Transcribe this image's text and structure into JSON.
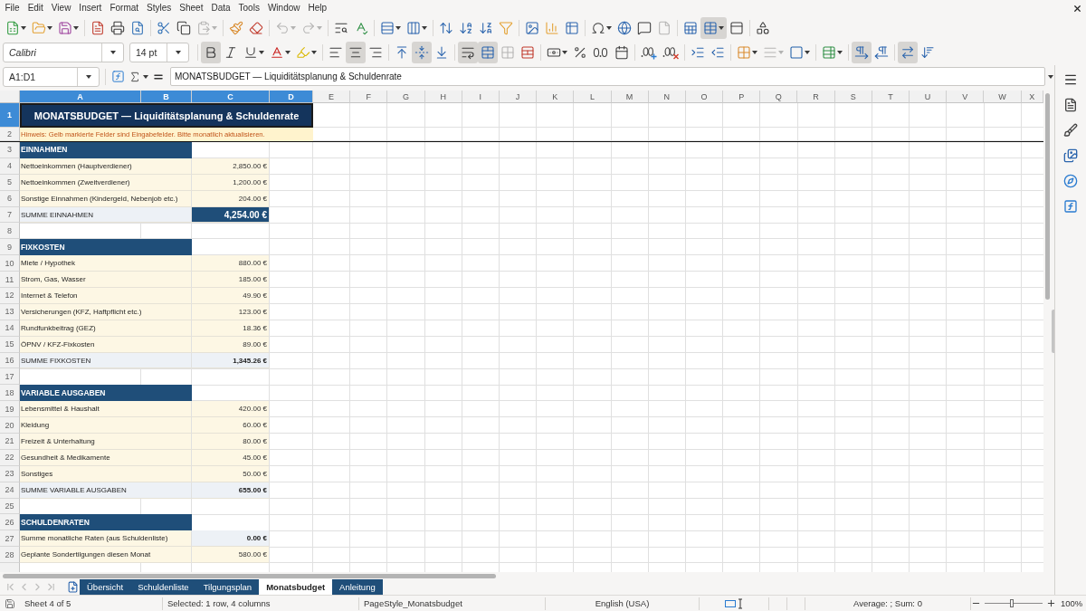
{
  "menu": [
    "File",
    "Edit",
    "View",
    "Insert",
    "Format",
    "Styles",
    "Sheet",
    "Data",
    "Tools",
    "Window",
    "Help"
  ],
  "standard_toolbar": {
    "paste": {
      "disabled": true
    },
    "undo": {
      "disabled": true
    },
    "redo": {
      "disabled": true
    },
    "headers_footers": {
      "disabled": true
    },
    "freeze_cells": {
      "pressed": true
    }
  },
  "formatting_toolbar": {
    "font_name": "Calibri",
    "font_size": "14 pt",
    "bold": {
      "pressed": true
    },
    "italic": {
      "pressed": false
    },
    "underline": {
      "pressed": false
    },
    "align_left": {
      "pressed": false
    },
    "align_center": {
      "pressed": true
    },
    "align_right": {
      "pressed": false
    },
    "align_top": {
      "pressed": false
    },
    "align_middle": {
      "pressed": true
    },
    "align_bottom": {
      "pressed": false
    },
    "wrap_text": {
      "pressed": true
    },
    "merge_and_center": {
      "pressed": true
    },
    "merge_cells": {
      "disabled": true
    },
    "border_style": {
      "disabled": true
    },
    "left_to_right": {
      "pressed": true
    },
    "right_to_left": {
      "pressed": false
    },
    "text_horizontal": {
      "pressed": true
    },
    "text_vertical": {
      "pressed": false
    }
  },
  "formula_bar": {
    "name_box": "A1:D1",
    "content": "MONATSBUDGET — Liquiditätsplanung & Schuldenrate"
  },
  "sheet": {
    "columns": [
      {
        "label": "A",
        "selected": true
      },
      {
        "label": "B",
        "selected": true
      },
      {
        "label": "C",
        "selected": true
      },
      {
        "label": "D",
        "selected": true
      },
      {
        "label": "E",
        "selected": false
      },
      {
        "label": "F",
        "selected": false
      },
      {
        "label": "G",
        "selected": false
      },
      {
        "label": "H",
        "selected": false
      },
      {
        "label": "I",
        "selected": false
      },
      {
        "label": "J",
        "selected": false
      },
      {
        "label": "K",
        "selected": false
      },
      {
        "label": "L",
        "selected": false
      },
      {
        "label": "M",
        "selected": false
      },
      {
        "label": "N",
        "selected": false
      },
      {
        "label": "O",
        "selected": false
      },
      {
        "label": "P",
        "selected": false
      },
      {
        "label": "Q",
        "selected": false
      },
      {
        "label": "R",
        "selected": false
      },
      {
        "label": "S",
        "selected": false
      },
      {
        "label": "T",
        "selected": false
      },
      {
        "label": "U",
        "selected": false
      },
      {
        "label": "V",
        "selected": false
      },
      {
        "label": "W",
        "selected": false
      },
      {
        "label": "X",
        "selected": false
      }
    ],
    "rows": [
      {
        "number": "1",
        "selected": true,
        "kind": "title",
        "label": "MONATSBUDGET — Liquiditätsplanung & Schuldenrate"
      },
      {
        "number": "2",
        "selected": false,
        "kind": "note",
        "label": "Hinweis: Gelb markierte Felder sind Eingabefelder. Bitte monatlich aktualisieren."
      },
      {
        "number": "3",
        "selected": false,
        "kind": "section",
        "label": "EINNAHMEN"
      },
      {
        "number": "4",
        "selected": false,
        "kind": "entry",
        "label": "Nettoeinkommen (Hauptverdiener)",
        "value": "2,850.00 €"
      },
      {
        "number": "5",
        "selected": false,
        "kind": "entry",
        "label": "Nettoeinkommen (Zweitverdiener)",
        "value": "1,200.00 €"
      },
      {
        "number": "6",
        "selected": false,
        "kind": "entry",
        "label": "Sonstige Einnahmen (Kindergeld, Nebenjob etc.)",
        "value": "204.00 €"
      },
      {
        "number": "7",
        "selected": false,
        "kind": "grand_total",
        "label": "SUMME EINNAHMEN",
        "value": "4,254.00 €"
      },
      {
        "number": "8",
        "selected": false,
        "kind": "blank"
      },
      {
        "number": "9",
        "selected": false,
        "kind": "section",
        "label": "FIXKOSTEN"
      },
      {
        "number": "10",
        "selected": false,
        "kind": "entry",
        "label": "Miete / Hypothek",
        "value": "880.00 €"
      },
      {
        "number": "11",
        "selected": false,
        "kind": "entry",
        "label": "Strom, Gas, Wasser",
        "value": "185.00 €"
      },
      {
        "number": "12",
        "selected": false,
        "kind": "entry",
        "label": "Internet & Telefon",
        "value": "49.90 €"
      },
      {
        "number": "13",
        "selected": false,
        "kind": "entry",
        "label": "Versicherungen (KFZ, Haftpflicht etc.)",
        "value": "123.00 €"
      },
      {
        "number": "14",
        "selected": false,
        "kind": "entry",
        "label": "Rundfunkbeitrag (GEZ)",
        "value": "18.36 €"
      },
      {
        "number": "15",
        "selected": false,
        "kind": "entry",
        "label": "ÖPNV / KFZ-Fixkosten",
        "value": "89.00 €"
      },
      {
        "number": "16",
        "selected": false,
        "kind": "total",
        "label": "SUMME FIXKOSTEN",
        "value": "1,345.26 €"
      },
      {
        "number": "17",
        "selected": false,
        "kind": "blank"
      },
      {
        "number": "18",
        "selected": false,
        "kind": "section",
        "label": "VARIABLE AUSGABEN"
      },
      {
        "number": "19",
        "selected": false,
        "kind": "entry",
        "label": "Lebensmittel & Haushalt",
        "value": "420.00 €"
      },
      {
        "number": "20",
        "selected": false,
        "kind": "entry",
        "label": "Kleidung",
        "value": "60.00 €"
      },
      {
        "number": "21",
        "selected": false,
        "kind": "entry",
        "label": "Freizeit & Unterhaltung",
        "value": "80.00 €"
      },
      {
        "number": "22",
        "selected": false,
        "kind": "entry",
        "label": "Gesundheit & Medikamente",
        "value": "45.00 €"
      },
      {
        "number": "23",
        "selected": false,
        "kind": "entry",
        "label": "Sonstiges",
        "value": "50.00 €"
      },
      {
        "number": "24",
        "selected": false,
        "kind": "total",
        "label": "SUMME VARIABLE AUSGABEN",
        "value": "655.00 €"
      },
      {
        "number": "25",
        "selected": false,
        "kind": "blank"
      },
      {
        "number": "26",
        "selected": false,
        "kind": "section",
        "label": "SCHULDENRATEN"
      },
      {
        "number": "27",
        "selected": false,
        "kind": "linked",
        "label": "Summe monatliche Raten (aus Schuldenliste)",
        "value": "0.00 €"
      },
      {
        "number": "28",
        "selected": false,
        "kind": "entry",
        "label": "Geplante Sondertilgungen diesen Monat",
        "value": "580.00 €"
      }
    ]
  },
  "sheet_tab_bar": {
    "navigation": {
      "disabled": true
    },
    "tabs": [
      {
        "label": "Übersicht",
        "selected": false
      },
      {
        "label": "Schuldenliste",
        "selected": false
      },
      {
        "label": "Tilgungsplan",
        "selected": false
      },
      {
        "label": "Monatsbudget",
        "selected": true
      },
      {
        "label": "Anleitung",
        "selected": false
      }
    ]
  },
  "status_bar": {
    "sheet": "Sheet 4 of 5",
    "selection": "Selected: 1 row, 4 columns",
    "page_style": "PageStyle_Monatsbudget",
    "language": "English (USA)",
    "summary": "Average: ; Sum: 0",
    "zoom_slider": {
      "level": 0.47
    },
    "zoom": "100%"
  }
}
